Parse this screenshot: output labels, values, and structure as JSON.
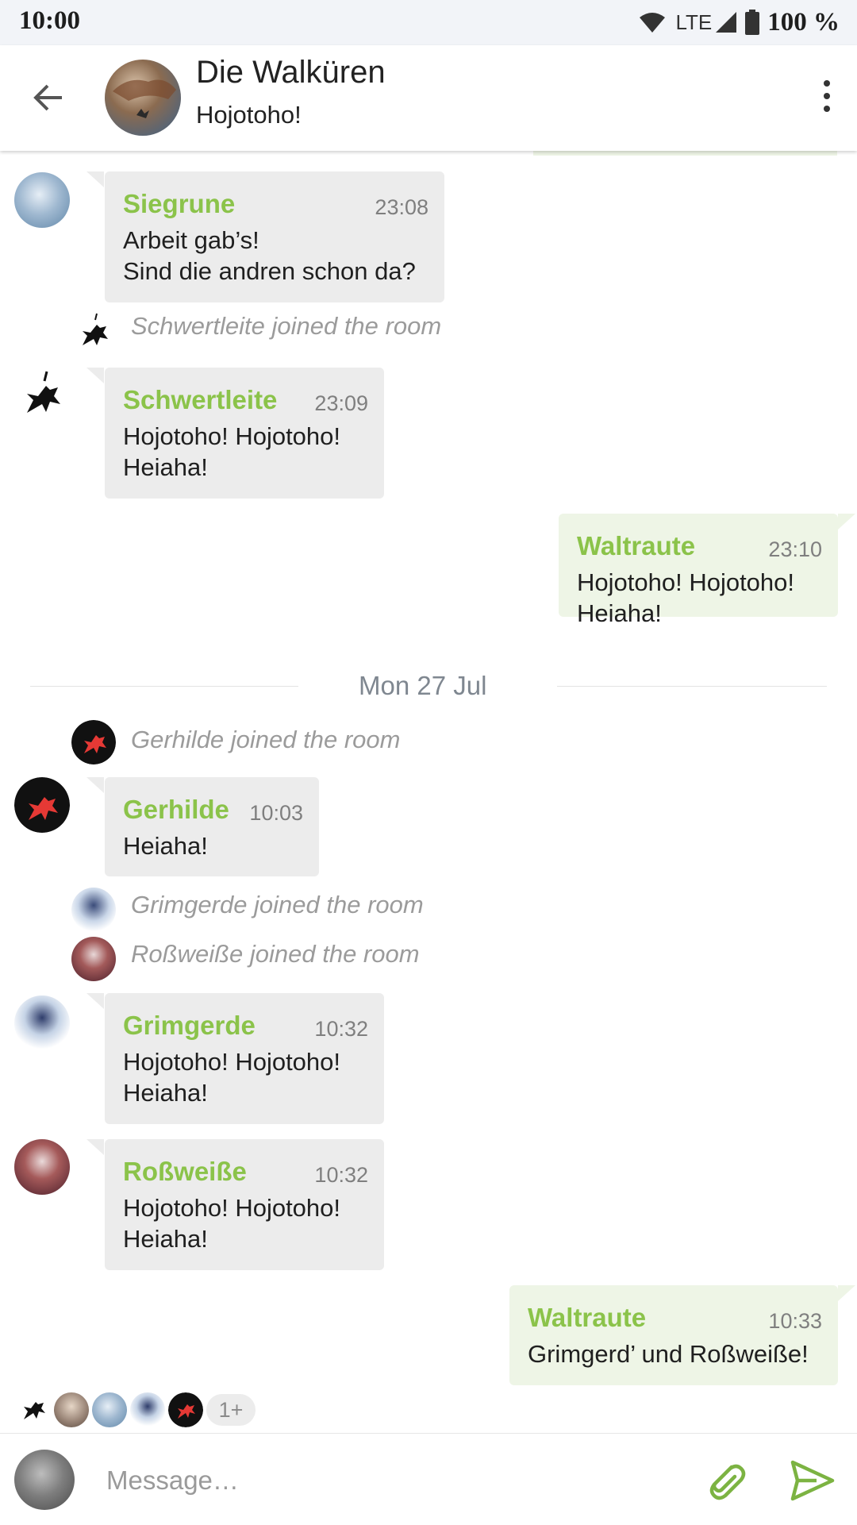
{
  "status_bar": {
    "time": "10:00",
    "network": "LTE",
    "battery": "100 %"
  },
  "toolbar": {
    "title": "Die Walküren",
    "topic": "Hojotoho!"
  },
  "colors": {
    "accent": "#8bc34a",
    "incoming_bubble": "#ececec",
    "outgoing_bubble": "#eef5e6",
    "event_text": "#9b9b9b"
  },
  "timeline": {
    "msg1": {
      "sender": "Siegrune",
      "time": "23:08",
      "body": "Arbeit gab’s!\nSind die andren schon da?"
    },
    "event1": {
      "text": "Schwertleite joined the room"
    },
    "msg2": {
      "sender": "Schwertleite",
      "time": "23:09",
      "body": "Hojotoho! Hojotoho!\nHeiaha!"
    },
    "msg3": {
      "sender": "Waltraute",
      "time": "23:10",
      "body": "Hojotoho! Hojotoho!\nHeiaha!"
    },
    "day_separator": "Mon 27 Jul",
    "event2": {
      "text": "Gerhilde joined the room"
    },
    "msg4": {
      "sender": "Gerhilde",
      "time": "10:03",
      "body": "Heiaha!"
    },
    "event3": {
      "text": "Grimgerde joined the room"
    },
    "event4": {
      "text": "Roßweiße joined the room"
    },
    "msg5": {
      "sender": "Grimgerde",
      "time": "10:32",
      "body": "Hojotoho! Hojotoho!\nHeiaha!"
    },
    "msg6": {
      "sender": "Roßweiße",
      "time": "10:32",
      "body": "Hojotoho! Hojotoho!\nHeiaha!"
    },
    "msg7": {
      "sender": "Waltraute",
      "time": "10:33",
      "body": "Grimgerd’ und Roßweiße!"
    }
  },
  "read_receipts": {
    "more": "1+"
  },
  "composer": {
    "placeholder": "Message…"
  }
}
